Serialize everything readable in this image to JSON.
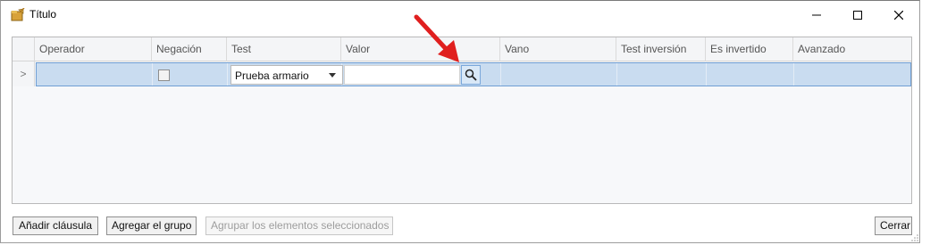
{
  "window": {
    "title": "Título",
    "icon": "folder-edit-icon",
    "controls": [
      "minimize-icon",
      "maximize-icon",
      "close-icon"
    ]
  },
  "grid": {
    "columns": [
      "Operador",
      "Negación",
      "Test",
      "Valor",
      "Vano",
      "Test inversión",
      "Es invertido",
      "Avanzado"
    ],
    "row": {
      "indicator": ">",
      "negacion_checked": false,
      "test_value": "Prueba armario",
      "valor_value": "",
      "search_icon": "search-icon"
    }
  },
  "annotation": {
    "type": "red-arrow",
    "color": "#e01f1f"
  },
  "buttons": {
    "add_clause": "Añadir cláusula",
    "add_group": "Agregar el grupo",
    "group_selected": "Agrupar los elementos seleccionados",
    "close": "Cerrar"
  },
  "colors": {
    "selected_row": "#c9dcf0",
    "selected_border": "#6f9ed4",
    "header": "#f4f5f7"
  }
}
